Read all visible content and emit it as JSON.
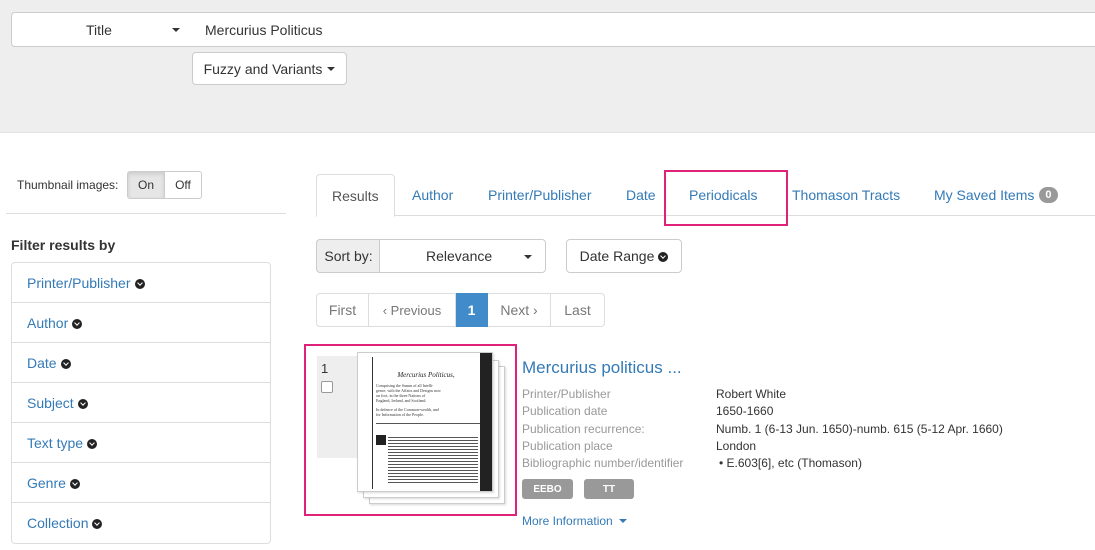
{
  "search": {
    "field_label": "Title",
    "query": "Mercurius Politicus",
    "mode_label": "Fuzzy and Variants"
  },
  "thumbnails": {
    "label": "Thumbnail images:",
    "on_label": "On",
    "off_label": "Off"
  },
  "filters": {
    "title": "Filter results by",
    "items": [
      "Printer/Publisher",
      "Author",
      "Date",
      "Subject",
      "Text type",
      "Genre",
      "Collection"
    ]
  },
  "tabs": {
    "results": "Results",
    "author": "Author",
    "printer": "Printer/Publisher",
    "date": "Date",
    "periodicals": "Periodicals",
    "thomason": "Thomason Tracts",
    "saved": "My Saved Items",
    "saved_count": "0"
  },
  "sort": {
    "label": "Sort by:",
    "value": "Relevance",
    "date_range_label": "Date Range"
  },
  "pagination": {
    "first": "First",
    "previous": "‹ Previous",
    "current": "1",
    "next": "Next ›",
    "last": "Last"
  },
  "result": {
    "number": "1",
    "title": "Mercurius politicus ...",
    "labels": {
      "publisher": "Printer/Publisher",
      "date": "Publication date",
      "recurrence": "Publication recurrence:",
      "place": "Publication place",
      "identifier": "Bibliographic number/identifier"
    },
    "values": {
      "publisher": "Robert White",
      "date": "1650-1660",
      "recurrence": "Numb. 1 (6-13 Jun. 1650)-numb. 615 (5-12 Apr. 1660)",
      "place": "London",
      "identifier": "E.603[6], etc (Thomason)"
    },
    "tags": [
      "EEBO",
      "TT"
    ],
    "more_info": "More Information",
    "thumbnail_page": {
      "heading": "Mercurius Politicus,",
      "lines": [
        "Comprising the Summ of all Intelli-",
        "gence, with the Affairs and Designs now",
        "on foot, in the three Nations of",
        "England, Ireland, and Scotland.",
        "In defence of the Common-wealth, and",
        "for Information of the People."
      ]
    }
  },
  "colors": {
    "link": "#337ab7",
    "highlight": "#e0217a",
    "active_page": "#428bca"
  }
}
